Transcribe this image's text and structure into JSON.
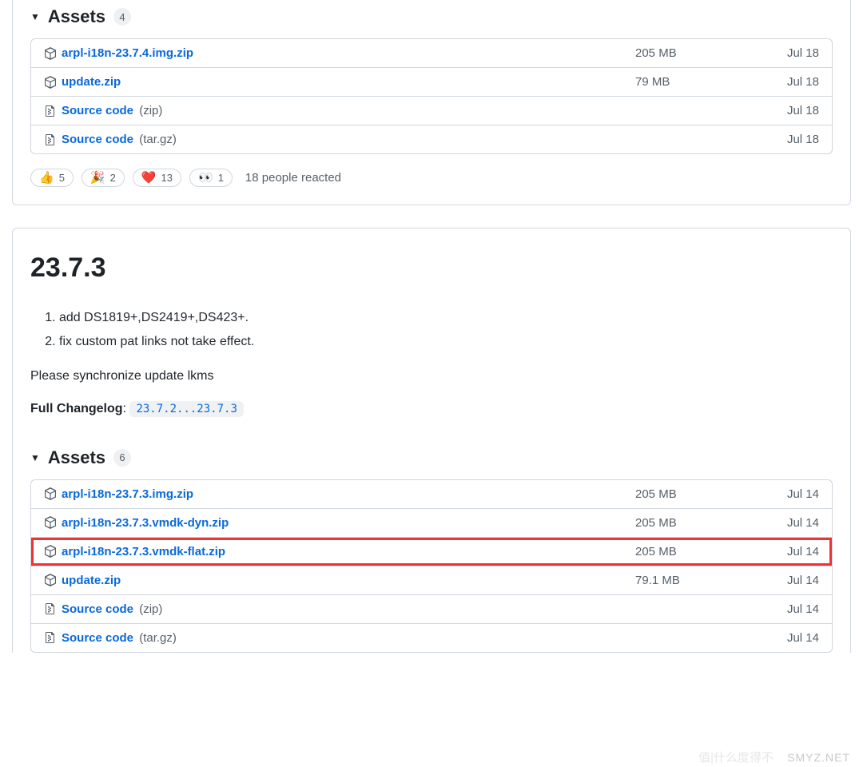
{
  "release1": {
    "assets_label": "Assets",
    "assets_count": "4",
    "rows": [
      {
        "name": "arpl-i18n-23.7.4.img.zip",
        "paren": "",
        "size": "205 MB",
        "date": "Jul 18",
        "icon": "package"
      },
      {
        "name": "update.zip",
        "paren": "",
        "size": "79 MB",
        "date": "Jul 18",
        "icon": "package"
      },
      {
        "name": "Source code ",
        "paren": "(zip)",
        "size": "",
        "date": "Jul 18",
        "icon": "zip"
      },
      {
        "name": "Source code ",
        "paren": "(tar.gz)",
        "size": "",
        "date": "Jul 18",
        "icon": "zip"
      }
    ],
    "reactions": [
      {
        "emoji": "👍",
        "count": "5"
      },
      {
        "emoji": "🎉",
        "count": "2"
      },
      {
        "emoji": "❤️",
        "count": "13"
      },
      {
        "emoji": "👀",
        "count": "1"
      }
    ],
    "reactions_summary": "18 people reacted"
  },
  "release2": {
    "title": "23.7.3",
    "changes": [
      "add DS1819+,DS2419+,DS423+.",
      "fix custom pat links not take effect."
    ],
    "sync_note": "Please synchronize update lkms",
    "full_changelog_label": "Full Changelog",
    "compare_text": "23.7.2...23.7.3",
    "assets_label": "Assets",
    "assets_count": "6",
    "rows": [
      {
        "name": "arpl-i18n-23.7.3.img.zip",
        "paren": "",
        "size": "205 MB",
        "date": "Jul 14",
        "icon": "package",
        "highlight": false
      },
      {
        "name": "arpl-i18n-23.7.3.vmdk-dyn.zip",
        "paren": "",
        "size": "205 MB",
        "date": "Jul 14",
        "icon": "package",
        "highlight": false
      },
      {
        "name": "arpl-i18n-23.7.3.vmdk-flat.zip",
        "paren": "",
        "size": "205 MB",
        "date": "Jul 14",
        "icon": "package",
        "highlight": true
      },
      {
        "name": "update.zip",
        "paren": "",
        "size": "79.1 MB",
        "date": "Jul 14",
        "icon": "package",
        "highlight": false
      },
      {
        "name": "Source code ",
        "paren": "(zip)",
        "size": "",
        "date": "Jul 14",
        "icon": "zip",
        "highlight": false
      },
      {
        "name": "Source code ",
        "paren": "(tar.gz)",
        "size": "",
        "date": "Jul 14",
        "icon": "zip",
        "highlight": false
      }
    ]
  },
  "watermark": "SMYZ.NET",
  "watermark2": "值|什么度得不"
}
